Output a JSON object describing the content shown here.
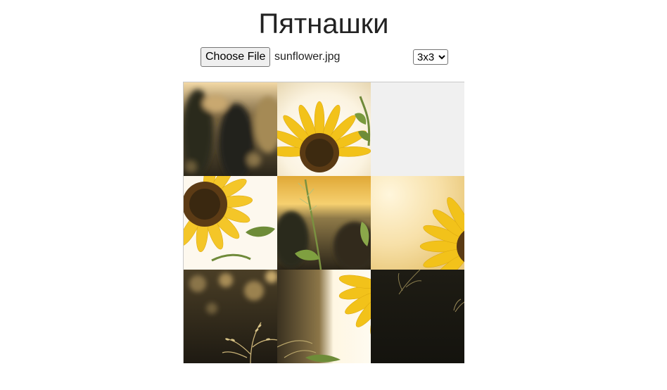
{
  "page": {
    "title": "Пятнашки"
  },
  "file_input": {
    "button_label": "Choose File",
    "file_name": "sunflower.jpg"
  },
  "size_select": {
    "selected": "3x3",
    "options": [
      "3x3"
    ]
  },
  "board": {
    "grid": 3,
    "empty_color": "#f0f0f0",
    "tiles": [
      {
        "piece": "blurred-foliage",
        "empty": false
      },
      {
        "piece": "sunflower-bloom-top",
        "empty": false
      },
      {
        "piece": "",
        "empty": true
      },
      {
        "piece": "sunflower-bloom-left",
        "empty": false
      },
      {
        "piece": "stem-and-sunset",
        "empty": false
      },
      {
        "piece": "sunflower-petals-edge",
        "empty": false
      },
      {
        "piece": "grass-seedheads",
        "empty": false
      },
      {
        "piece": "sunflower-petals-bottom",
        "empty": false
      },
      {
        "piece": "dark-foliage",
        "empty": false
      }
    ]
  }
}
